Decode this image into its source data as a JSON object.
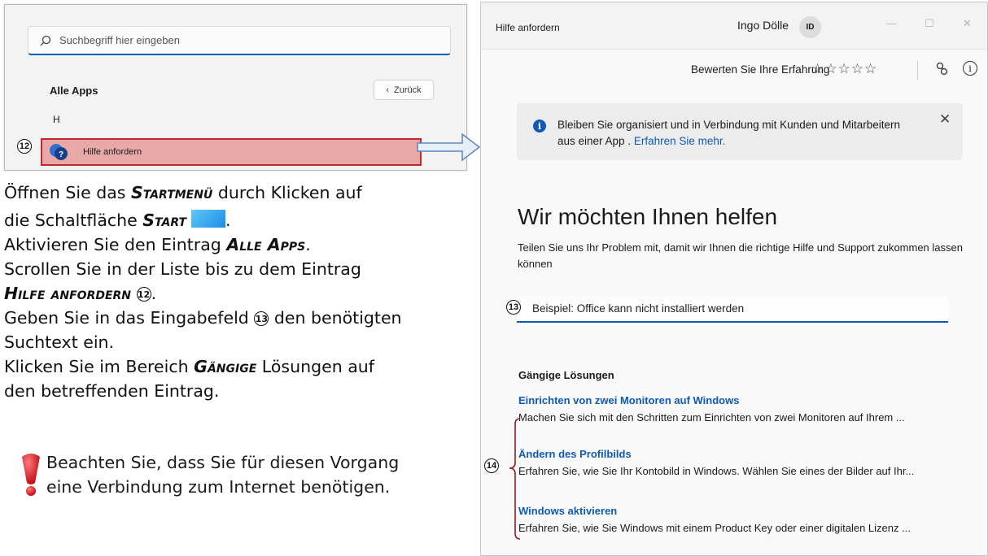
{
  "startmenu": {
    "search_placeholder": "Suchbegriff hier eingeben",
    "all_apps": "Alle Apps",
    "back_label": "Zurück",
    "letter": "H",
    "app_entry": "Hilfe anfordern",
    "marker": "12"
  },
  "instructions": {
    "l1_a": "Öffnen Sie das ",
    "l1_b": "Startmenü",
    "l1_c": " durch Klicken auf",
    "l2_a": "die Schaltfläche ",
    "l2_b": "Start",
    "l2_c": ".",
    "l3_a": "Aktivieren Sie den Eintrag ",
    "l3_b": "Alle Apps",
    "l3_c": ".",
    "l4": "Scrollen Sie in der Liste bis zu dem Eintrag",
    "l5_b": "Hilfe anfordern",
    "l5_m": "12",
    "l5_c": ".",
    "l6_a": "Geben Sie in das Eingabefeld ",
    "l6_m": "13",
    "l6_c": " den benötigten",
    "l7": "Suchtext ein.",
    "l8_a": "Klicken Sie im Bereich ",
    "l8_b": "Gängige",
    "l8_c": " Lösungen auf",
    "l9": "den betreffenden Eintrag.",
    "warn_1": "Beachten Sie, dass Sie für diesen Vorgang",
    "warn_2": "eine Verbindung zum Internet benötigen."
  },
  "app": {
    "title": "Hilfe anfordern",
    "user_name": "Ingo Dölle",
    "user_initials": "ID",
    "rate_label": "Bewerten Sie Ihre Erfahrung",
    "stars": "☆☆☆☆☆",
    "banner_text": "Bleiben Sie organisiert und in Verbindung mit Kunden und Mitarbeitern aus einer App . ",
    "banner_link": "Erfahren Sie mehr.",
    "heading": "Wir möchten Ihnen helfen",
    "subtext": "Teilen Sie uns Ihr Problem mit, damit wir Ihnen die richtige Hilfe und Support zukommen lassen können",
    "input_placeholder": "Beispiel: Office kann nicht installiert werden",
    "marker_input": "13",
    "solutions_heading": "Gängige Lösungen",
    "marker_solutions": "14",
    "solutions": [
      {
        "title": "Einrichten von zwei Monitoren auf Windows",
        "desc": "Machen Sie sich mit den Schritten zum Einrichten von zwei Monitoren auf Ihrem ..."
      },
      {
        "title": "Ändern des Profilbilds",
        "desc": "Erfahren Sie, wie Sie Ihr Kontobild in Windows. Wählen Sie eines der Bilder auf Ihr..."
      },
      {
        "title": "Windows aktivieren",
        "desc": "Erfahren Sie, wie Sie Windows mit einem Product Key oder einer digitalen Lizenz ..."
      }
    ]
  },
  "colors": {
    "accent": "#0f5ab5",
    "highlight_fill": "#e9a8a8",
    "highlight_border": "#c0282d",
    "warning": "#d8151b"
  }
}
